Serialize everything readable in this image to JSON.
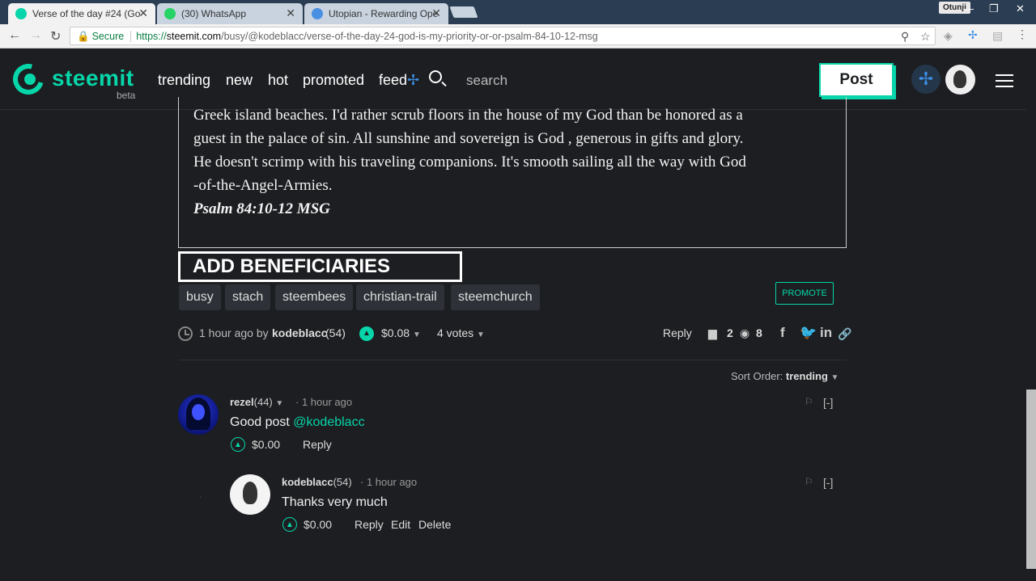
{
  "browser": {
    "tabs": [
      {
        "title": "Verse of the day #24 (Go",
        "active": true
      },
      {
        "title": "(30) WhatsApp",
        "active": false
      },
      {
        "title": "Utopian - Rewarding Ope",
        "active": false
      }
    ],
    "profile_name": "Otunji",
    "url_secure_label": "Secure",
    "url_scheme": "https://",
    "url_host": "steemit.com",
    "url_path": "/busy/@kodeblacc/verse-of-the-day-24-god-is-my-priority-or-or-psalm-84-10-12-msg"
  },
  "header": {
    "logo_text": "steemit",
    "logo_beta": "beta",
    "nav": [
      "trending",
      "new",
      "hot",
      "promoted",
      "feed"
    ],
    "search_placeholder": "search",
    "post_label": "Post"
  },
  "article": {
    "lines": [
      "Greek island beaches. I'd rather scrub floors in the house of my God than be honored as a",
      "guest in the palace of sin. All sunshine and sovereign is God , generous in gifts and glory.",
      "He doesn't scrimp with his traveling companions. It's smooth sailing all the way with God",
      "-of-the-Angel-Armies."
    ],
    "reference": "Psalm 84:10-12 MSG",
    "beneficiaries_label": "ADD BENEFICIARIES",
    "tags": [
      "busy",
      "stach",
      "steembees",
      "christian-trail",
      "steemchurch"
    ],
    "promote_label": "PROMOTE",
    "meta": {
      "time": "1 hour ago by",
      "author": "kodeblacc",
      "reputation": "(54)",
      "payout": "$0.08",
      "votes": "4 votes",
      "reply_label": "Reply",
      "comments_count": "2",
      "views_count": "8"
    }
  },
  "sort": {
    "label": "Sort Order:",
    "value": "trending"
  },
  "comments": [
    {
      "author": "rezel",
      "reputation": "(44)",
      "time": "1 hour ago",
      "text": "Good post ",
      "mention": "@kodeblacc",
      "payout": "$0.00",
      "actions": [
        "Reply"
      ],
      "collapse": "[-]"
    },
    {
      "author": "kodeblacc",
      "reputation": "(54)",
      "time": "1 hour ago",
      "text": "Thanks very much",
      "payout": "$0.00",
      "actions": [
        "Reply",
        "Edit",
        "Delete"
      ],
      "collapse": "[-]"
    }
  ],
  "colors": {
    "accent": "#06d6a9",
    "background": "#1c1e21",
    "busy_blue": "#3d8ee0"
  }
}
